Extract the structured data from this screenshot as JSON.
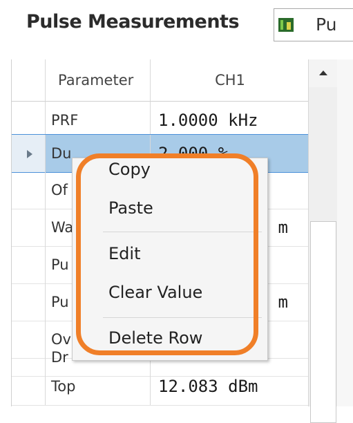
{
  "panel": {
    "title": "Pulse Measurements",
    "dropdown_text": "Pu",
    "dropdown_icon": "chart-icon"
  },
  "table": {
    "headers": {
      "parameter": "Parameter",
      "ch1": "CH1"
    },
    "rows": [
      {
        "parameter": "PRF",
        "ch1": "1.0000 kHz"
      },
      {
        "parameter": "Du",
        "ch1": "2.000 %"
      },
      {
        "parameter": "Of",
        "ch1": ""
      },
      {
        "parameter": "Wa",
        "ch1": "m"
      },
      {
        "parameter": "Pu",
        "ch1": ""
      },
      {
        "parameter": "Pu",
        "ch1": "m"
      },
      {
        "parameter": "Ov",
        "ch1": ""
      },
      {
        "parameter": "Dr",
        "ch1": ""
      },
      {
        "parameter": "Top",
        "ch1": "12.083 dBm"
      }
    ]
  },
  "context_menu": {
    "items": [
      "Copy",
      "Paste",
      "Edit",
      "Clear Value",
      "Delete Row"
    ]
  },
  "colors": {
    "highlight": "#f07f28",
    "selected_row": "#a8cbe8"
  }
}
